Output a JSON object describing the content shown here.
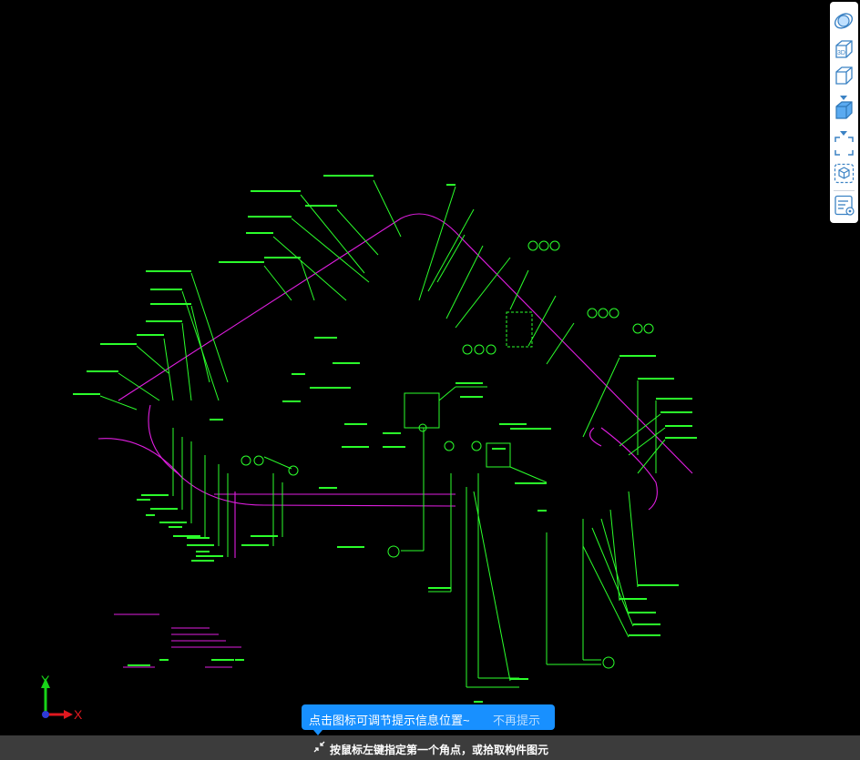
{
  "toolbar": {
    "tools": [
      {
        "icon": "orbit-icon"
      },
      {
        "icon": "3d-view-icon",
        "label": "3D"
      },
      {
        "icon": "wireframe-box-icon"
      },
      {
        "icon": "solid-box-icon"
      },
      {
        "icon": "fit-view-icon"
      },
      {
        "icon": "component-select-icon"
      },
      {
        "icon": "properties-panel-icon"
      }
    ]
  },
  "axis": {
    "x": "X",
    "y": "Y",
    "x_color": "#e0181f",
    "y_color": "#18d318",
    "origin_color": "#2e3ad6"
  },
  "tooltip": {
    "message": "点击图标可调节提示信息位置~",
    "dismiss": "不再提示"
  },
  "status": {
    "text": "按鼠标左键指定第一个角点，或拾取构件图元"
  },
  "colors": {
    "lines": "#2bff2b",
    "curves": "#e01ee0",
    "accent": "#1890ff",
    "background": "#000000"
  }
}
